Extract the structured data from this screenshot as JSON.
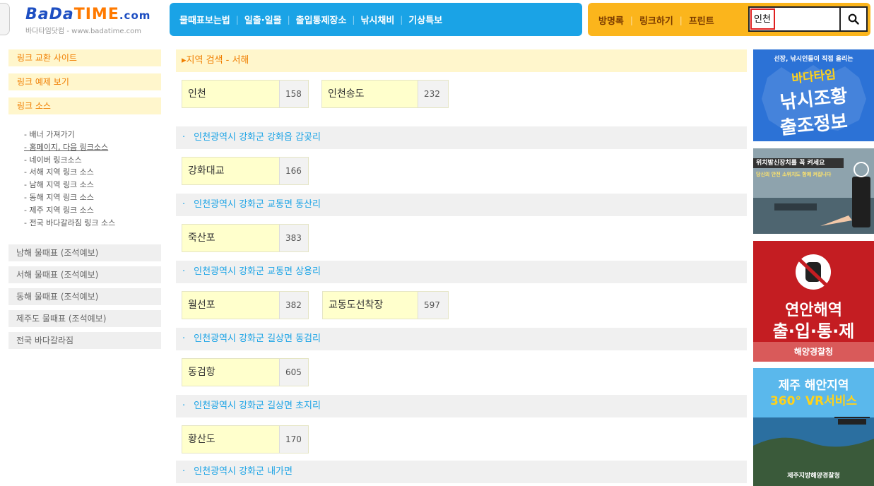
{
  "logo": {
    "bada": "BaDa",
    "time": "TIME",
    "com": ".com",
    "subtitle": "바다타임닷컴 - www.badatime.com"
  },
  "nav_blue": [
    "물때표보는법",
    "일출·일몰",
    "출입통제장소",
    "낚시채비",
    "기상특보"
  ],
  "nav_orange": [
    "방명록",
    "링크하기",
    "프린트"
  ],
  "search": {
    "value": "인천",
    "icon": "search-icon"
  },
  "sidebar": {
    "orange_items": [
      "링크 교환 사이트",
      "링크 예제 보기",
      "링크 소스"
    ],
    "source_list": [
      "- 배너 가져가기",
      "- 홈페이지, 다음 링크소스",
      "- 네이버 링크소스",
      "- 서해 지역 링크 소스",
      "- 남해 지역 링크 소스",
      "- 동해 지역 링크 소스",
      "- 제주 지역 링크 소스",
      "- 전국 바다갈라짐 링크 소스"
    ],
    "gray_items": [
      "남해 물때표 (조석예보)",
      "서해 물때표 (조석예보)",
      "동해 물때표 (조석예보)",
      "제주도 물때표 (조석예보)",
      "전국 바다갈라짐"
    ]
  },
  "main": {
    "region_header": "▸지역 검색 - 서해",
    "top_chips": [
      {
        "name": "인천",
        "count": "158"
      },
      {
        "name": "인천송도",
        "count": "232"
      }
    ],
    "groups": [
      {
        "title": "인천광역시 강화군 강화읍 갑곶리",
        "chips": [
          {
            "name": "강화대교",
            "count": "166"
          }
        ]
      },
      {
        "title": "인천광역시 강화군 교동면 동산리",
        "chips": [
          {
            "name": "죽산포",
            "count": "383"
          }
        ]
      },
      {
        "title": "인천광역시 강화군 교동면 상용리",
        "chips": [
          {
            "name": "월선포",
            "count": "382"
          },
          {
            "name": "교동도선착장",
            "count": "597"
          }
        ]
      },
      {
        "title": "인천광역시 강화군 길상면 동검리",
        "chips": [
          {
            "name": "동검항",
            "count": "605"
          }
        ]
      },
      {
        "title": "인천광역시 강화군 길상면 초지리",
        "chips": [
          {
            "name": "황산도",
            "count": "170"
          }
        ]
      },
      {
        "title": "인천광역시 강화군 내가면",
        "chips": []
      }
    ],
    "bullet": "·"
  },
  "ads": {
    "ad1": {
      "line1": "선장, 낚시인들이 직접 올리는",
      "line2": "바다타임",
      "line3": "낚시조황",
      "line4": "출조정보"
    },
    "ad2": {
      "line1": "위치발신장치를 꼭 켜세요",
      "line2": "당신의 안전 소위치도 함께 켜집니다"
    },
    "ad3": {
      "line1": "연안해역",
      "line2": "출·입·통·제",
      "line3": "해양경찰청"
    },
    "ad4": {
      "line1": "제주 해안지역",
      "line2": "360° VR서비스",
      "line3": "제주지방해양경찰청"
    }
  },
  "colors": {
    "nav_blue": "#1aa3e6",
    "nav_orange": "#fbb51c",
    "accent_orange": "#f07e00",
    "accent_blue": "#1aa3e6",
    "chip_name_bg": "#ffffcc"
  }
}
